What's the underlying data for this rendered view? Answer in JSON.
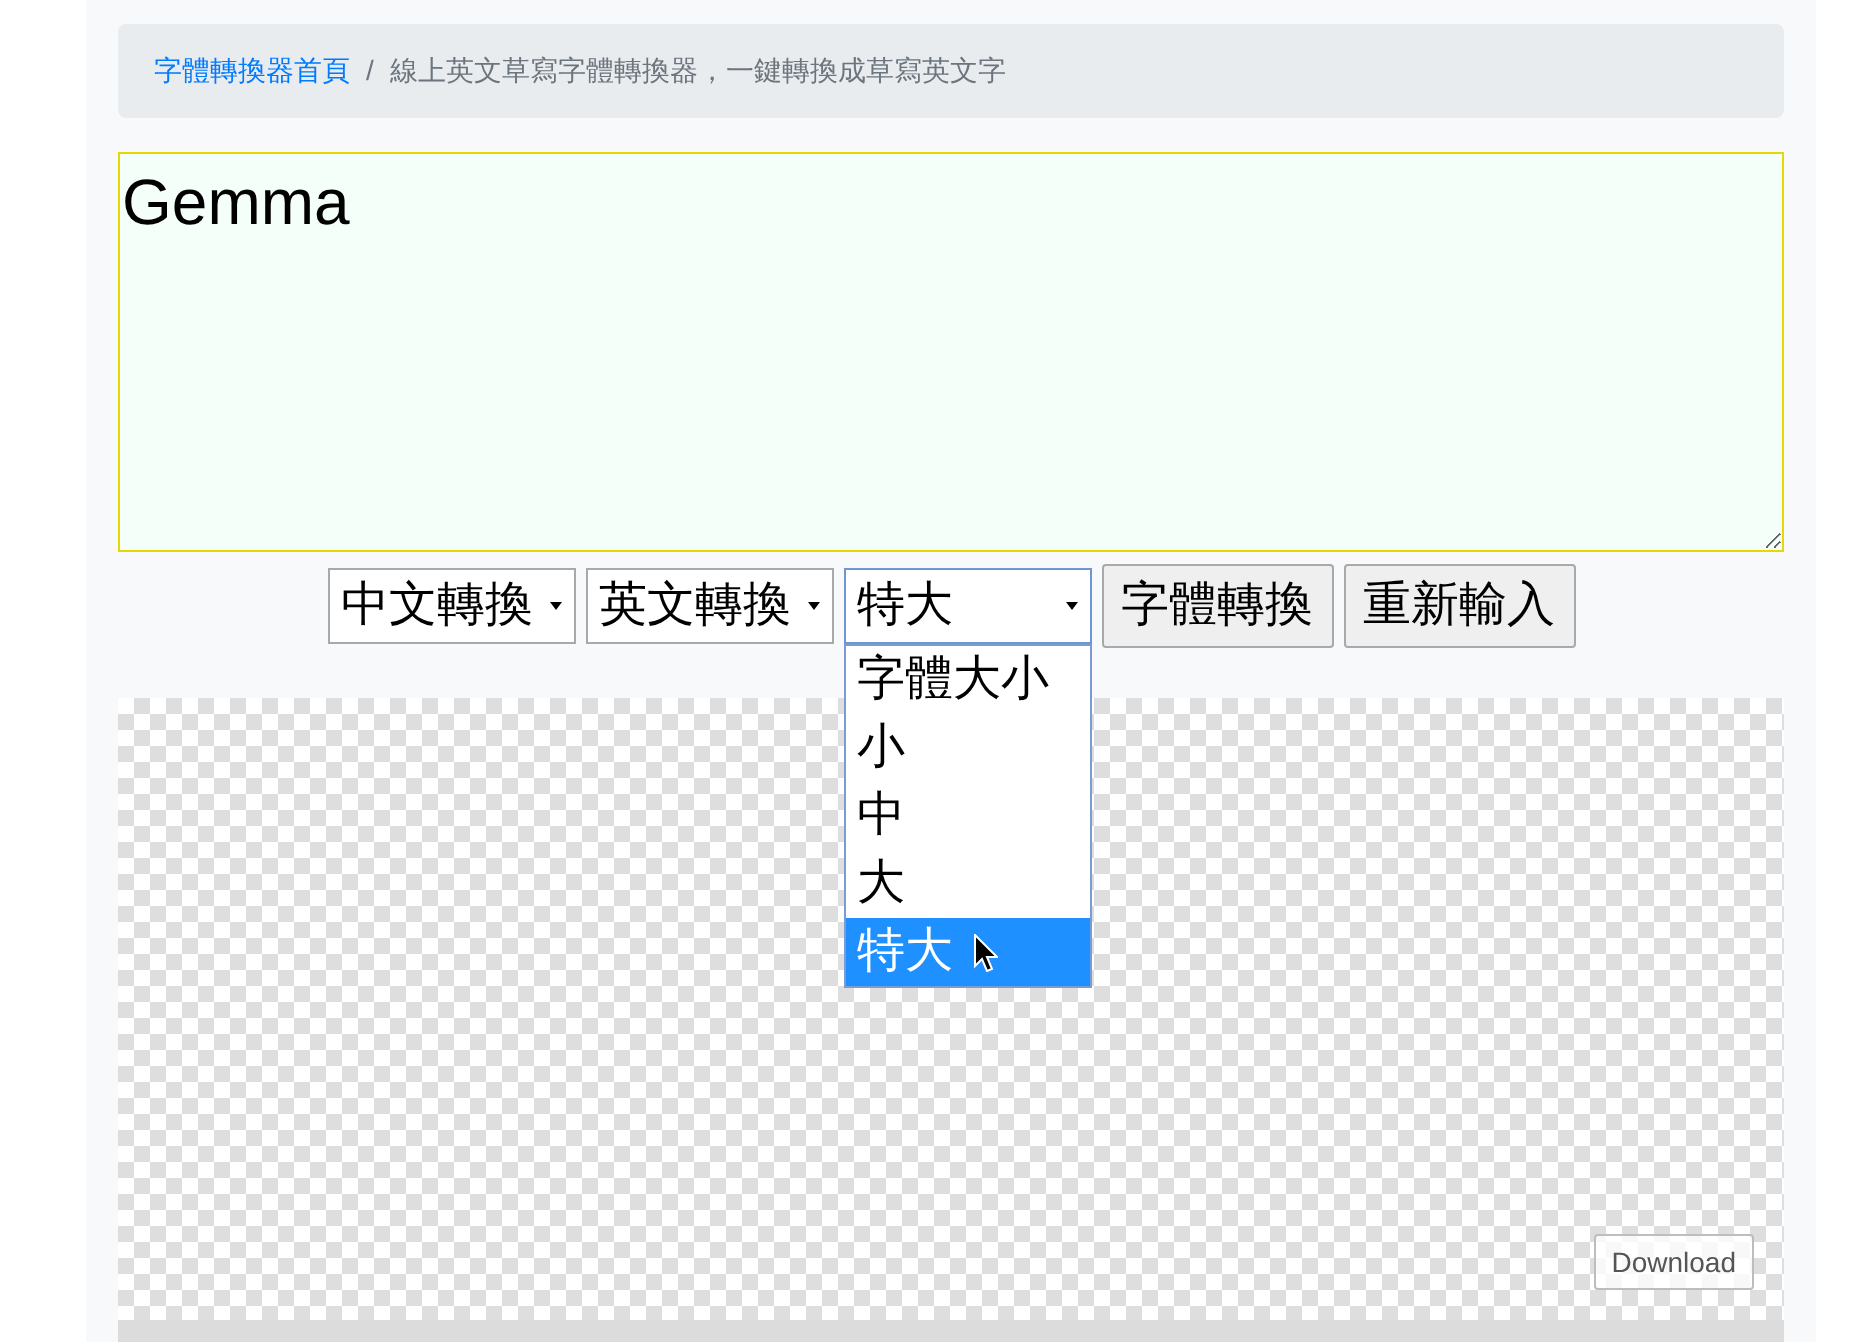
{
  "breadcrumb": {
    "separator": "/",
    "items": [
      {
        "kind": "link",
        "label": "字體轉換器首頁"
      },
      {
        "kind": "current",
        "label": "線上英文草寫字體轉換器，一鍵轉換成草寫英文字"
      }
    ]
  },
  "text_input": {
    "value": "Gemma"
  },
  "controls": [
    {
      "kind": "select",
      "value": "中文轉換",
      "expanded": false
    },
    {
      "kind": "select",
      "value": "英文轉換",
      "expanded": false
    },
    {
      "kind": "select",
      "value": "特大",
      "expanded": true,
      "options": [
        {
          "label": "字體大小",
          "selected": false
        },
        {
          "label": "小",
          "selected": false
        },
        {
          "label": "中",
          "selected": false
        },
        {
          "label": "大",
          "selected": false
        },
        {
          "label": "特大",
          "selected": true
        }
      ]
    },
    {
      "kind": "button",
      "label": "字體轉換"
    },
    {
      "kind": "button",
      "label": "重新輸入"
    }
  ],
  "canvas": {
    "download_button": "Download"
  }
}
